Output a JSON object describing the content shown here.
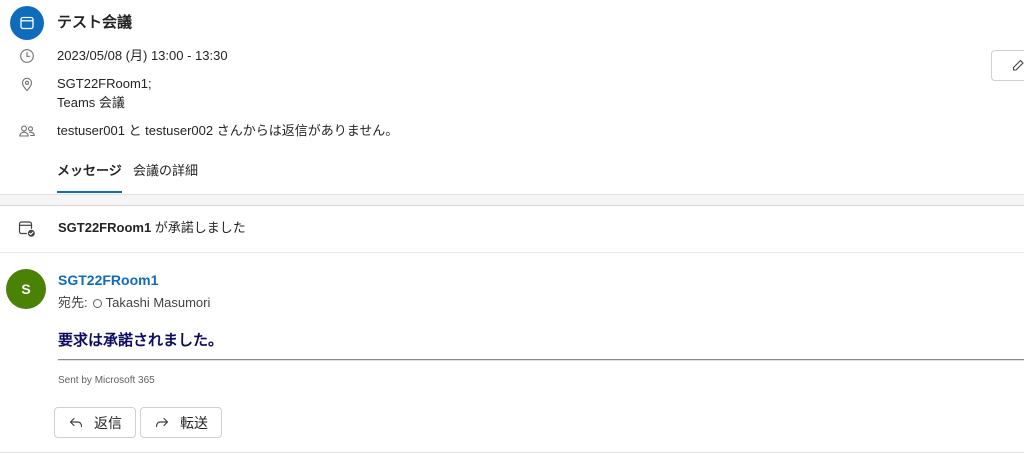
{
  "meeting": {
    "title": "テスト会議",
    "datetime": "2023/05/08 (月) 13:00 - 13:30",
    "location_line1": "SGT22FRoom1;",
    "location_line2": "Teams 会議",
    "attendee_status": "testuser001 と testuser002 さんからは返信がありません。",
    "tabs": [
      {
        "label": "メッセージ",
        "active": true
      },
      {
        "label": "会議の詳細",
        "active": false
      }
    ]
  },
  "response_summary": {
    "sender": "SGT22FRoom1",
    "text": " が承諾しました"
  },
  "message": {
    "avatar_initial": "S",
    "sender": "SGT22FRoom1",
    "to_label": "宛先:",
    "recipient": "Takashi Masumori",
    "body": "要求は承諾されました。",
    "footer": "Sent by Microsoft 365"
  },
  "actions": {
    "reply": "返信",
    "forward": "転送"
  },
  "icons": {
    "meeting": "calendar-icon",
    "time": "clock-icon",
    "location": "location-icon",
    "attendees": "people-icon",
    "response": "calendar-check-icon",
    "edit": "pencil-icon",
    "presence": "presence-icon",
    "reply": "reply-icon",
    "forward": "forward-icon"
  },
  "colors": {
    "accent": "#0f6cbd",
    "avatar": "#498205",
    "body_text": "#0b0b63",
    "text": "#242424",
    "icon_gray": "#707070"
  }
}
